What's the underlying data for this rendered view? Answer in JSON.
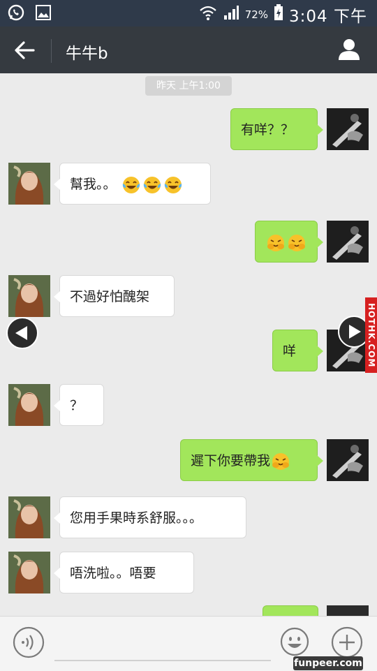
{
  "status_bar": {
    "battery": "72%",
    "time": "3:04 下午"
  },
  "title_bar": {
    "title": "牛牛b"
  },
  "timestamp": "昨天 上午1:00",
  "messages": [
    {
      "side": "out",
      "text": "有咩？？",
      "emojis": []
    },
    {
      "side": "in",
      "text": "幫我。。",
      "emojis": [
        "tears-of-joy-emoji",
        "tears-of-joy-emoji",
        "tears-of-joy-emoji"
      ]
    },
    {
      "side": "out",
      "text": "",
      "emojis": [
        "covering-face-emoji",
        "covering-face-emoji"
      ]
    },
    {
      "side": "in",
      "text": "不過好怕醜架",
      "emojis": []
    },
    {
      "side": "out",
      "text": "咩",
      "emojis": []
    },
    {
      "side": "in",
      "text": "？",
      "emojis": []
    },
    {
      "side": "out",
      "text": "遲下你要帶我",
      "emojis": [
        "covering-face-emoji"
      ]
    },
    {
      "side": "in",
      "text": "您用手果時系舒服。。。",
      "emojis": []
    },
    {
      "side": "in",
      "text": "唔洗啦。。唔要",
      "emojis": []
    }
  ],
  "watermark": "HOTHK.COM",
  "credit": "funpeer.com",
  "colors": {
    "status_bar": "#2f3a4a",
    "title_bar": "#353a40",
    "chat_bg": "#ebebeb",
    "out_bubble": "#a2e65b",
    "in_bubble": "#ffffff",
    "watermark": "#d62020"
  }
}
